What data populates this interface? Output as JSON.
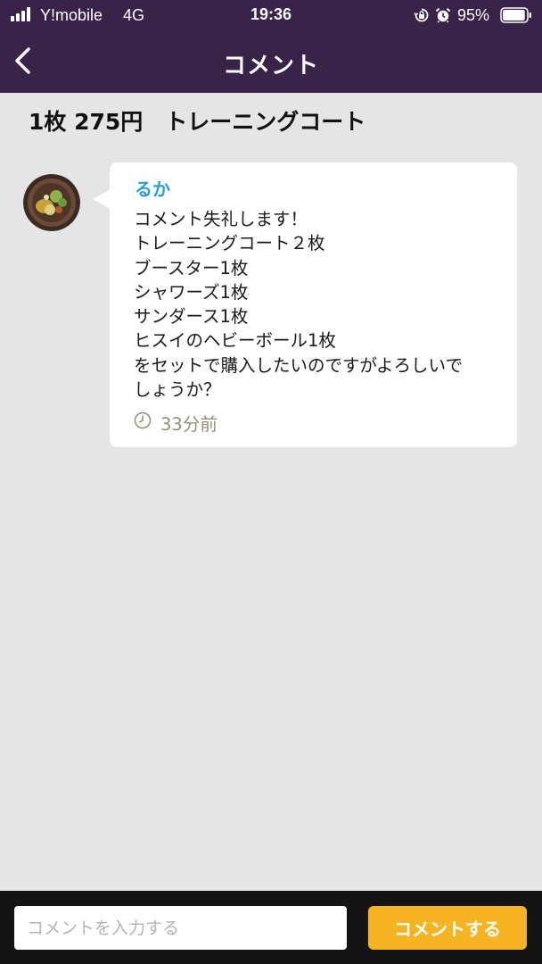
{
  "status_bar": {
    "carrier": "Y!mobile",
    "network": "4G",
    "time": "19:36",
    "battery_percent": "95%",
    "battery_level": 0.95,
    "icons": [
      "signal-icon",
      "orientation-lock-icon",
      "alarm-icon",
      "battery-icon"
    ]
  },
  "nav": {
    "title": "コメント",
    "back_icon": "chevron-left-icon"
  },
  "item": {
    "title": "1枚 275円　トレーニングコート"
  },
  "comments": [
    {
      "author": "るか",
      "lines": [
        "コメント失礼します！",
        "トレーニングコート２枚",
        "ブースター1枚",
        "シャワーズ1枚",
        "サンダース1枚",
        "ヒスイのヘビーボール1枚",
        "をセットで購入したいのですがよろしいで",
        "しょうか？"
      ],
      "time": "33分前",
      "time_icon": "clock-icon"
    }
  ],
  "input": {
    "placeholder": "コメントを入力する",
    "value": "",
    "submit_label": "コメントする"
  },
  "colors": {
    "header": "#3a2348",
    "background": "#e5e5e5",
    "author": "#2b9fd8",
    "timestamp": "#958f78",
    "submit_button": "#f6b322",
    "input_bar": "#141414"
  }
}
